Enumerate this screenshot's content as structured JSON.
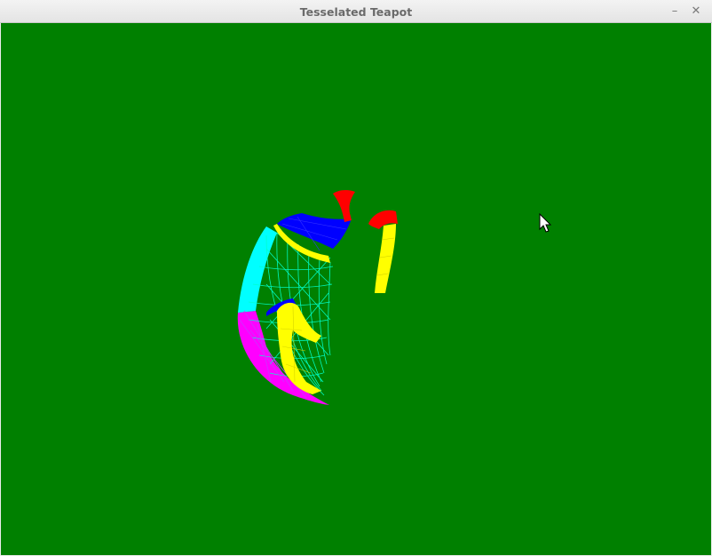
{
  "window": {
    "title": "Tesselated Teapot",
    "minimize_glyph": "–",
    "close_glyph": "✕"
  },
  "scene": {
    "background_color": "#008000",
    "mesh_colors": {
      "body_wireframe": "#00ffcc",
      "lid": "#0000ff",
      "spout_tip": "#ff0000",
      "handle_and_rim": "#ffff00",
      "bottom": "#ff00ff",
      "side_edge": "#00ffff"
    },
    "cursor_icon": "arrow-cursor-icon"
  }
}
